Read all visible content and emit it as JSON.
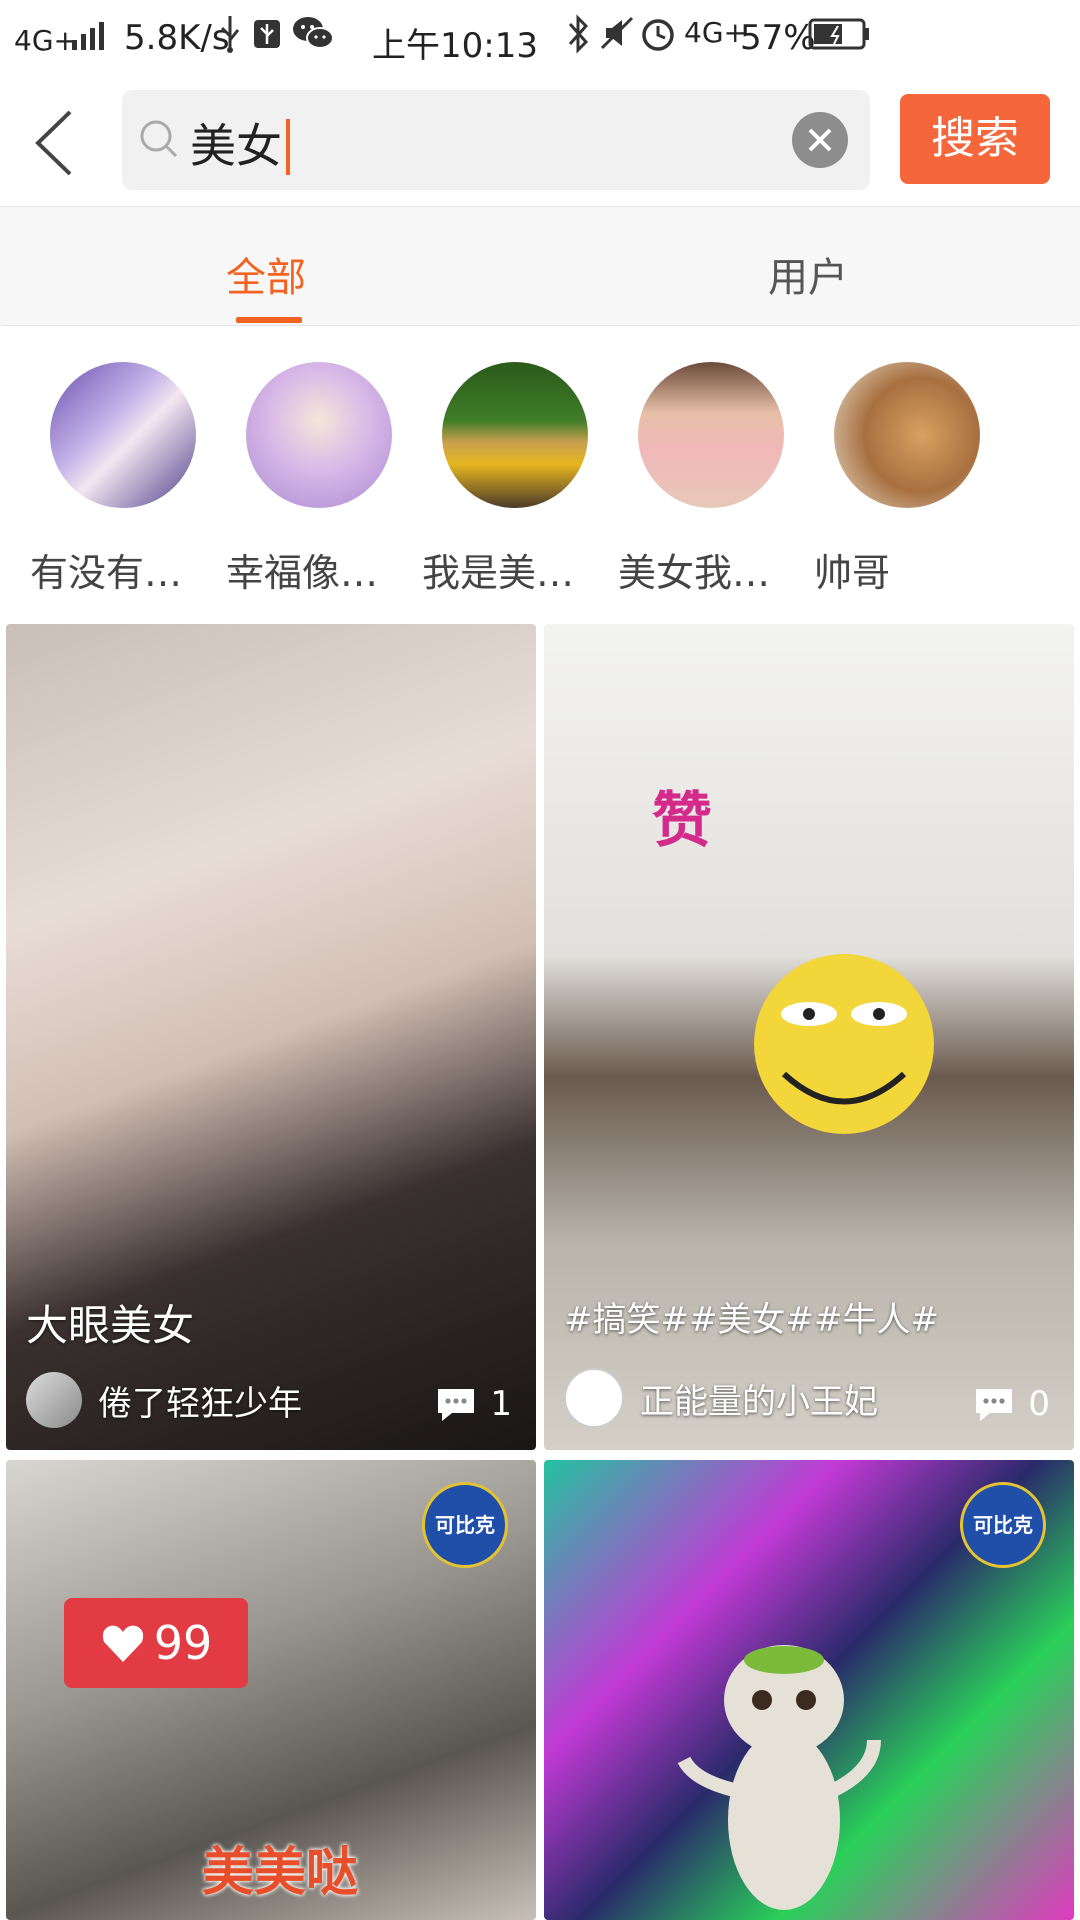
{
  "status_bar": {
    "network_left": "4G+",
    "speed": "5.8K/s",
    "time": "上午10:13",
    "network_right": "4G+",
    "battery": "57%"
  },
  "search": {
    "query": "美女",
    "button_label": "搜索"
  },
  "tabs": [
    {
      "label": "全部",
      "active": true
    },
    {
      "label": "用户",
      "active": false
    }
  ],
  "users": [
    {
      "name": "有没有…"
    },
    {
      "name": "幸福像…"
    },
    {
      "name": "我是美…"
    },
    {
      "name": "美女我…"
    },
    {
      "name": "帅哥"
    }
  ],
  "videos": [
    {
      "title": "大眼美女",
      "author": "倦了轻狂少年",
      "comments": "1"
    },
    {
      "title": "#搞笑##美女##牛人#",
      "author": "正能量的小王妃",
      "comments": "0",
      "sticker": "赞"
    },
    {
      "like_badge": "99",
      "watermark": "美美哒",
      "logo": "可比克"
    },
    {
      "logo": "可比克"
    }
  ],
  "colors": {
    "accent": "#f26322",
    "search_button": "#f5663a"
  }
}
